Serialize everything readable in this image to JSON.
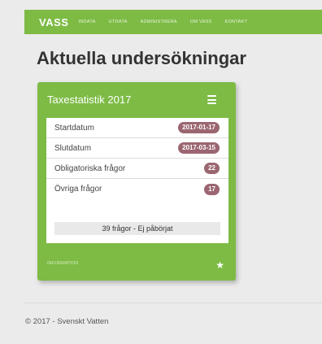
{
  "navbar": {
    "brand": "VASS",
    "links": [
      "INDATA",
      "UTDATA",
      "ADMINISTRERA",
      "OM VASS",
      "KONTAKT"
    ]
  },
  "page": {
    "title": "Aktuella undersökningar"
  },
  "card": {
    "title": "Taxestatistik 2017",
    "rows": [
      {
        "label": "Startdatum",
        "badge": "2017-01-17"
      },
      {
        "label": "Slutdatum",
        "badge": "2017-03-15"
      },
      {
        "label": "Obligatoriska frågor",
        "badge": "22"
      },
      {
        "label": "Övriga frågor",
        "badge": "17"
      }
    ],
    "summary": "39 frågor - Ej påbörjat",
    "footer_link": "INFORMATION"
  },
  "footer": {
    "text": "© 2017 - Svenskt Vatten"
  },
  "colors": {
    "accent": "#7dbb45",
    "badge": "#9b6671"
  },
  "icons": {
    "menu": "hamburger-icon",
    "favorite": "star-icon"
  }
}
